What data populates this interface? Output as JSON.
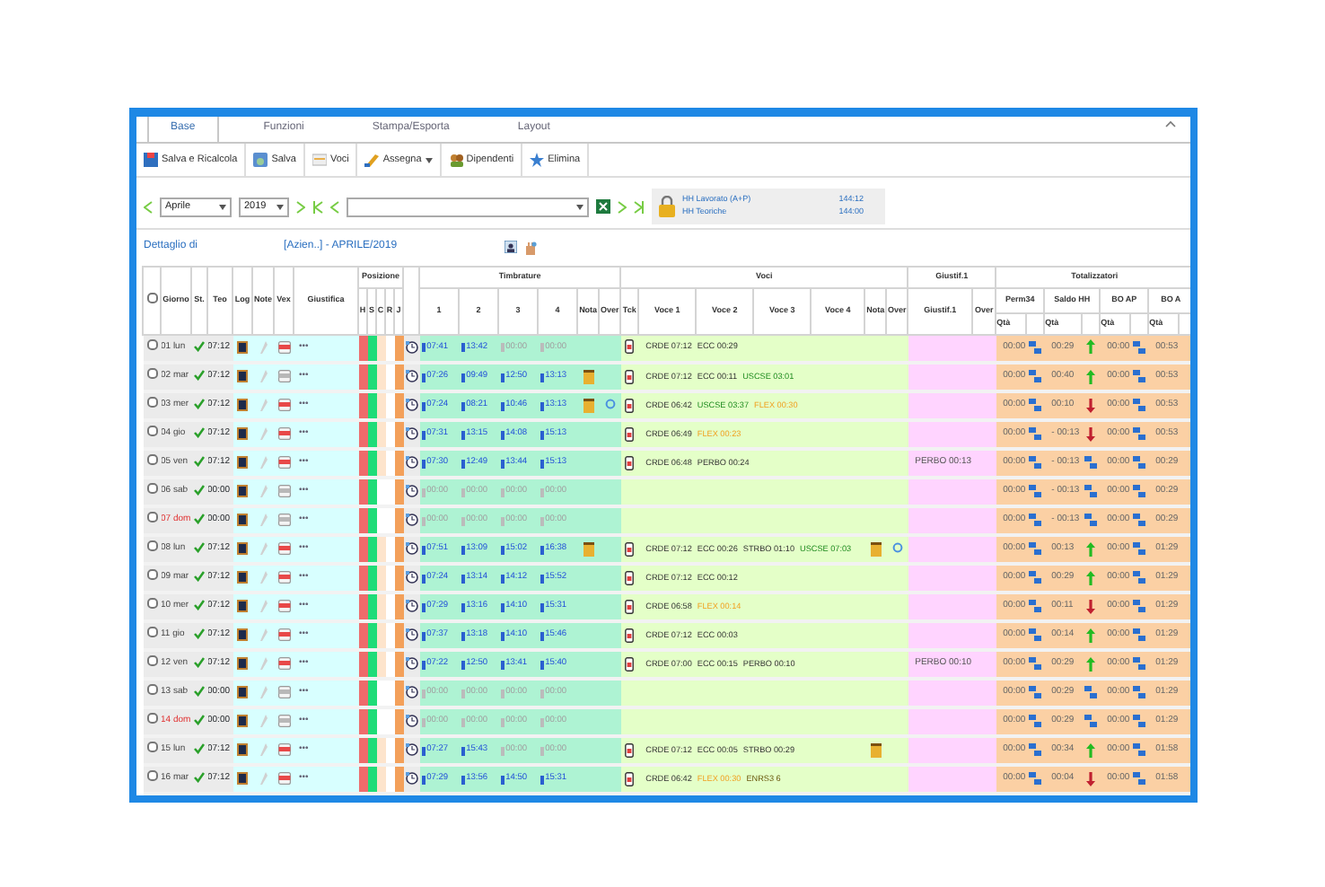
{
  "ribbon": {
    "tabs": [
      {
        "label": "Base",
        "selected": true
      },
      {
        "label": "Funzioni",
        "selected": false
      },
      {
        "label": "Stampa/Esporta",
        "selected": false
      },
      {
        "label": "Layout",
        "selected": false
      }
    ],
    "buttons": [
      {
        "label": "Salva e Ricalcola",
        "dropdown": false
      },
      {
        "label": "Salva",
        "dropdown": false
      },
      {
        "label": "Voci",
        "dropdown": false
      },
      {
        "label": "Assegna",
        "dropdown": true
      },
      {
        "label": "Dipendenti",
        "dropdown": false
      },
      {
        "label": "Elimina",
        "dropdown": false
      }
    ]
  },
  "nav": {
    "month": "Aprile",
    "year": "2019",
    "locked": true,
    "hours": [
      {
        "label": "HH Lavorato (A+P)",
        "value": "144:12"
      },
      {
        "label": "HH Teoriche",
        "value": "144:00"
      }
    ]
  },
  "detail": {
    "label": "Dettaglio di",
    "value": "[Azien..] - APRILE/2019"
  },
  "table": {
    "all_checked": false,
    "groups": {
      "position": "Posizione",
      "stamps": "Timbrature",
      "items": "Voci",
      "just": "Giustif.1",
      "totals": "Totalizzatori"
    },
    "left_columns": [
      "Giorno",
      "St.",
      "Teo",
      "Log",
      "Note",
      "Vex",
      "Giustifica"
    ],
    "position_columns": [
      "H",
      "S",
      "C",
      "R",
      "J"
    ],
    "stamp_columns": [
      "1",
      "2",
      "3",
      "4",
      "Nota",
      "Over"
    ],
    "item_columns": [
      "Tck",
      "Voce 1",
      "Voce 2",
      "Voce 3",
      "Voce 4",
      "Nota",
      "Over"
    ],
    "just_columns": [
      "Giustif.1",
      "Over"
    ],
    "total_columns": [
      {
        "label": "Perm34",
        "sub": "Qtà"
      },
      {
        "label": "Saldo HH",
        "sub": "Qtà"
      },
      {
        "label": "BO AP",
        "sub": "Qtà"
      },
      {
        "label": "BO A",
        "sub": "Qtà"
      }
    ],
    "rows": [
      {
        "checked": false,
        "day": "01 lun",
        "holiday": false,
        "teo": "07:12",
        "vex_active": true,
        "giustifica": "•••",
        "pos_c": true,
        "times": [
          {
            "time": "07:41",
            "active": true
          },
          {
            "time": "13:42",
            "active": true
          },
          {
            "time": "00:00",
            "active": false
          },
          {
            "time": "00:00",
            "active": false
          }
        ],
        "note": false,
        "over": false,
        "tck": true,
        "voci": [
          {
            "text": "CRDE 07:12",
            "kind": "plain"
          },
          {
            "text": "ECC 00:29",
            "kind": "plain"
          }
        ],
        "voci_note": false,
        "voci_over": false,
        "giust": "",
        "perm": "00:00",
        "saldo": "00:29",
        "saldo_up": true,
        "saldo_down": false,
        "boap": "00:00",
        "boa": "00:53"
      },
      {
        "checked": false,
        "day": "02 mar",
        "holiday": false,
        "teo": "07:12",
        "vex_active": false,
        "giustifica": "•••",
        "pos_c": true,
        "times": [
          {
            "time": "07:26",
            "active": true
          },
          {
            "time": "09:49",
            "active": true
          },
          {
            "time": "12:50",
            "active": true
          },
          {
            "time": "13:13",
            "active": true
          }
        ],
        "note": true,
        "over": false,
        "tck": true,
        "voci": [
          {
            "text": "CRDE 07:12",
            "kind": "plain"
          },
          {
            "text": "ECC 00:11",
            "kind": "plain"
          },
          {
            "text": "USCSE 03:01",
            "kind": "green"
          }
        ],
        "voci_note": false,
        "voci_over": false,
        "giust": "",
        "perm": "00:00",
        "saldo": "00:40",
        "saldo_up": true,
        "saldo_down": false,
        "boap": "00:00",
        "boa": "00:53"
      },
      {
        "checked": false,
        "day": "03 mer",
        "holiday": false,
        "teo": "07:12",
        "vex_active": true,
        "giustifica": "•••",
        "pos_c": true,
        "times": [
          {
            "time": "07:24",
            "active": true
          },
          {
            "time": "08:21",
            "active": true
          },
          {
            "time": "10:46",
            "active": true
          },
          {
            "time": "13:13",
            "active": true
          }
        ],
        "note": true,
        "over": true,
        "tck": true,
        "voci": [
          {
            "text": "CRDE 06:42",
            "kind": "plain"
          },
          {
            "text": "USCSE 03:37",
            "kind": "green"
          },
          {
            "text": "FLEX 00:30",
            "kind": "orange"
          }
        ],
        "voci_note": false,
        "voci_over": false,
        "giust": "",
        "perm": "00:00",
        "saldo": "00:10",
        "saldo_up": false,
        "saldo_down": true,
        "boap": "00:00",
        "boa": "00:53"
      },
      {
        "checked": false,
        "day": "04 gio",
        "holiday": false,
        "teo": "07:12",
        "vex_active": true,
        "giustifica": "•••",
        "pos_c": true,
        "times": [
          {
            "time": "07:31",
            "active": true
          },
          {
            "time": "13:15",
            "active": true
          },
          {
            "time": "14:08",
            "active": true
          },
          {
            "time": "15:13",
            "active": true
          }
        ],
        "note": false,
        "over": false,
        "tck": true,
        "voci": [
          {
            "text": "CRDE 06:49",
            "kind": "plain"
          },
          {
            "text": "FLEX 00:23",
            "kind": "orange"
          }
        ],
        "voci_note": false,
        "voci_over": false,
        "giust": "",
        "perm": "00:00",
        "saldo": "- 00:13",
        "saldo_up": false,
        "saldo_down": true,
        "boap": "00:00",
        "boa": "00:53"
      },
      {
        "checked": false,
        "day": "05 ven",
        "holiday": false,
        "teo": "07:12",
        "vex_active": true,
        "giustifica": "•••",
        "pos_c": true,
        "times": [
          {
            "time": "07:30",
            "active": true
          },
          {
            "time": "12:49",
            "active": true
          },
          {
            "time": "13:44",
            "active": true
          },
          {
            "time": "15:13",
            "active": true
          }
        ],
        "note": false,
        "over": false,
        "tck": true,
        "voci": [
          {
            "text": "CRDE 06:48",
            "kind": "plain"
          },
          {
            "text": "PERBO 00:24",
            "kind": "plain"
          }
        ],
        "voci_note": false,
        "voci_over": false,
        "giust": "PERBO 00:13",
        "perm": "00:00",
        "saldo": "- 00:13",
        "saldo_up": false,
        "saldo_down": false,
        "boap": "00:00",
        "boa": "00:29"
      },
      {
        "checked": false,
        "day": "06 sab",
        "holiday": false,
        "teo": "00:00",
        "vex_active": false,
        "giustifica": "•••",
        "pos_c": false,
        "times": [
          {
            "time": "00:00",
            "active": false
          },
          {
            "time": "00:00",
            "active": false
          },
          {
            "time": "00:00",
            "active": false
          },
          {
            "time": "00:00",
            "active": false
          }
        ],
        "note": false,
        "over": false,
        "tck": false,
        "voci": [],
        "voci_note": false,
        "voci_over": false,
        "giust": "",
        "perm": "00:00",
        "saldo": "- 00:13",
        "saldo_up": false,
        "saldo_down": false,
        "boap": "00:00",
        "boa": "00:29"
      },
      {
        "checked": false,
        "day": "07 dom",
        "holiday": true,
        "teo": "00:00",
        "vex_active": false,
        "giustifica": "•••",
        "pos_c": false,
        "times": [
          {
            "time": "00:00",
            "active": false
          },
          {
            "time": "00:00",
            "active": false
          },
          {
            "time": "00:00",
            "active": false
          },
          {
            "time": "00:00",
            "active": false
          }
        ],
        "note": false,
        "over": false,
        "tck": false,
        "voci": [],
        "voci_note": false,
        "voci_over": false,
        "giust": "",
        "perm": "00:00",
        "saldo": "- 00:13",
        "saldo_up": false,
        "saldo_down": false,
        "boap": "00:00",
        "boa": "00:29"
      },
      {
        "checked": false,
        "day": "08 lun",
        "holiday": false,
        "teo": "07:12",
        "vex_active": true,
        "giustifica": "•••",
        "pos_c": true,
        "times": [
          {
            "time": "07:51",
            "active": true
          },
          {
            "time": "13:09",
            "active": true
          },
          {
            "time": "15:02",
            "active": true
          },
          {
            "time": "16:38",
            "active": true
          }
        ],
        "note": true,
        "over": false,
        "tck": true,
        "voci": [
          {
            "text": "CRDE 07:12",
            "kind": "plain"
          },
          {
            "text": "ECC 00:26",
            "kind": "plain"
          },
          {
            "text": "STRBO 01:10",
            "kind": "plain"
          },
          {
            "text": "USCSE 07:03",
            "kind": "green"
          }
        ],
        "voci_note": true,
        "voci_over": true,
        "giust": "",
        "perm": "00:00",
        "saldo": "00:13",
        "saldo_up": true,
        "saldo_down": false,
        "boap": "00:00",
        "boa": "01:29"
      },
      {
        "checked": false,
        "day": "09 mar",
        "holiday": false,
        "teo": "07:12",
        "vex_active": true,
        "giustifica": "•••",
        "pos_c": true,
        "times": [
          {
            "time": "07:24",
            "active": true
          },
          {
            "time": "13:14",
            "active": true
          },
          {
            "time": "14:12",
            "active": true
          },
          {
            "time": "15:52",
            "active": true
          }
        ],
        "note": false,
        "over": false,
        "tck": true,
        "voci": [
          {
            "text": "CRDE 07:12",
            "kind": "plain"
          },
          {
            "text": "ECC 00:12",
            "kind": "plain"
          }
        ],
        "voci_note": false,
        "voci_over": false,
        "giust": "",
        "perm": "00:00",
        "saldo": "00:29",
        "saldo_up": true,
        "saldo_down": false,
        "boap": "00:00",
        "boa": "01:29"
      },
      {
        "checked": false,
        "day": "10 mer",
        "holiday": false,
        "teo": "07:12",
        "vex_active": true,
        "giustifica": "•••",
        "pos_c": true,
        "times": [
          {
            "time": "07:29",
            "active": true
          },
          {
            "time": "13:16",
            "active": true
          },
          {
            "time": "14:10",
            "active": true
          },
          {
            "time": "15:31",
            "active": true
          }
        ],
        "note": false,
        "over": false,
        "tck": true,
        "voci": [
          {
            "text": "CRDE 06:58",
            "kind": "plain"
          },
          {
            "text": "FLEX 00:14",
            "kind": "orange"
          }
        ],
        "voci_note": false,
        "voci_over": false,
        "giust": "",
        "perm": "00:00",
        "saldo": "00:11",
        "saldo_up": false,
        "saldo_down": true,
        "boap": "00:00",
        "boa": "01:29"
      },
      {
        "checked": false,
        "day": "11 gio",
        "holiday": false,
        "teo": "07:12",
        "vex_active": true,
        "giustifica": "•••",
        "pos_c": true,
        "times": [
          {
            "time": "07:37",
            "active": true
          },
          {
            "time": "13:18",
            "active": true
          },
          {
            "time": "14:10",
            "active": true
          },
          {
            "time": "15:46",
            "active": true
          }
        ],
        "note": false,
        "over": false,
        "tck": true,
        "voci": [
          {
            "text": "CRDE 07:12",
            "kind": "plain"
          },
          {
            "text": "ECC 00:03",
            "kind": "plain"
          }
        ],
        "voci_note": false,
        "voci_over": false,
        "giust": "",
        "perm": "00:00",
        "saldo": "00:14",
        "saldo_up": true,
        "saldo_down": false,
        "boap": "00:00",
        "boa": "01:29"
      },
      {
        "checked": false,
        "day": "12 ven",
        "holiday": false,
        "teo": "07:12",
        "vex_active": true,
        "giustifica": "•••",
        "pos_c": true,
        "times": [
          {
            "time": "07:22",
            "active": true
          },
          {
            "time": "12:50",
            "active": true
          },
          {
            "time": "13:41",
            "active": true
          },
          {
            "time": "15:40",
            "active": true
          }
        ],
        "note": false,
        "over": false,
        "tck": true,
        "voci": [
          {
            "text": "CRDE 07:00",
            "kind": "plain"
          },
          {
            "text": "ECC 00:15",
            "kind": "plain"
          },
          {
            "text": "PERBO 00:10",
            "kind": "plain"
          }
        ],
        "voci_note": false,
        "voci_over": false,
        "giust": "PERBO 00:10",
        "perm": "00:00",
        "saldo": "00:29",
        "saldo_up": true,
        "saldo_down": false,
        "boap": "00:00",
        "boa": "01:29"
      },
      {
        "checked": false,
        "day": "13 sab",
        "holiday": false,
        "teo": "00:00",
        "vex_active": false,
        "giustifica": "•••",
        "pos_c": false,
        "times": [
          {
            "time": "00:00",
            "active": false
          },
          {
            "time": "00:00",
            "active": false
          },
          {
            "time": "00:00",
            "active": false
          },
          {
            "time": "00:00",
            "active": false
          }
        ],
        "note": false,
        "over": false,
        "tck": false,
        "voci": [],
        "voci_note": false,
        "voci_over": false,
        "giust": "",
        "perm": "00:00",
        "saldo": "00:29",
        "saldo_up": false,
        "saldo_down": false,
        "boap": "00:00",
        "boa": "01:29"
      },
      {
        "checked": false,
        "day": "14 dom",
        "holiday": true,
        "teo": "00:00",
        "vex_active": false,
        "giustifica": "•••",
        "pos_c": false,
        "times": [
          {
            "time": "00:00",
            "active": false
          },
          {
            "time": "00:00",
            "active": false
          },
          {
            "time": "00:00",
            "active": false
          },
          {
            "time": "00:00",
            "active": false
          }
        ],
        "note": false,
        "over": false,
        "tck": false,
        "voci": [],
        "voci_note": false,
        "voci_over": false,
        "giust": "",
        "perm": "00:00",
        "saldo": "00:29",
        "saldo_up": false,
        "saldo_down": false,
        "boap": "00:00",
        "boa": "01:29"
      },
      {
        "checked": false,
        "day": "15 lun",
        "holiday": false,
        "teo": "07:12",
        "vex_active": true,
        "giustifica": "•••",
        "pos_c": true,
        "times": [
          {
            "time": "07:27",
            "active": true
          },
          {
            "time": "15:43",
            "active": true
          },
          {
            "time": "00:00",
            "active": false
          },
          {
            "time": "00:00",
            "active": false
          }
        ],
        "note": false,
        "over": false,
        "tck": true,
        "voci": [
          {
            "text": "CRDE 07:12",
            "kind": "plain"
          },
          {
            "text": "ECC 00:05",
            "kind": "plain"
          },
          {
            "text": "STRBO 00:29",
            "kind": "plain"
          }
        ],
        "voci_note": true,
        "voci_over": false,
        "giust": "",
        "perm": "00:00",
        "saldo": "00:34",
        "saldo_up": true,
        "saldo_down": false,
        "boap": "00:00",
        "boa": "01:58"
      },
      {
        "checked": false,
        "day": "16 mar",
        "holiday": false,
        "teo": "07:12",
        "vex_active": true,
        "giustifica": "•••",
        "pos_c": true,
        "times": [
          {
            "time": "07:29",
            "active": true
          },
          {
            "time": "13:56",
            "active": true
          },
          {
            "time": "14:50",
            "active": true
          },
          {
            "time": "15:31",
            "active": true
          }
        ],
        "note": false,
        "over": false,
        "tck": true,
        "voci": [
          {
            "text": "CRDE 06:42",
            "kind": "plain"
          },
          {
            "text": "FLEX 00:30",
            "kind": "orange"
          },
          {
            "text": "ENRS3 6",
            "kind": "olive"
          }
        ],
        "voci_note": false,
        "voci_over": false,
        "giust": "",
        "perm": "00:00",
        "saldo": "00:04",
        "saldo_up": false,
        "saldo_down": true,
        "boap": "00:00",
        "boa": "01:58"
      }
    ]
  }
}
